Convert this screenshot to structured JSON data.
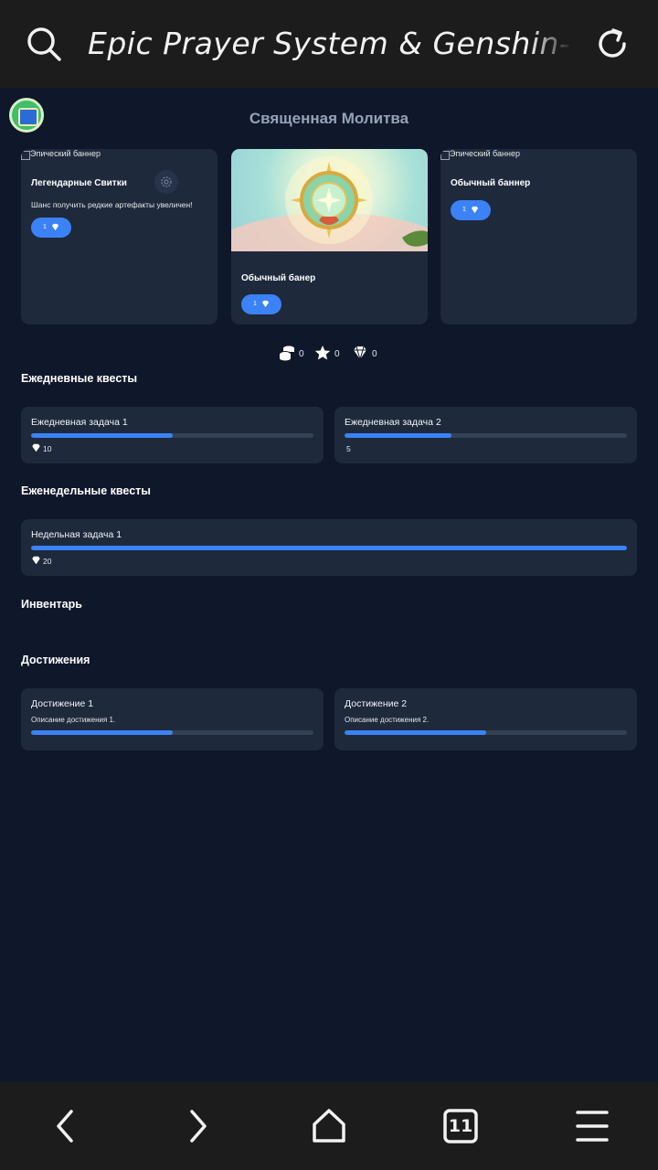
{
  "browser": {
    "title": "Epic Prayer System & Genshin-Sty",
    "tab_count": "11"
  },
  "page": {
    "title": "Священная Молитва"
  },
  "banners": [
    {
      "broken_alt": "Эпический баннер",
      "name": "Легендарные Свитки",
      "desc": "Шанс получить редкие артефакты увеличен!",
      "cost": "1"
    },
    {
      "name": "Обычный банер",
      "cost": "1"
    },
    {
      "broken_alt": "Эпический баннер",
      "name": "Обычный баннер",
      "cost": "1"
    }
  ],
  "currencies": [
    {
      "icon": "coins-icon",
      "value": "0"
    },
    {
      "icon": "star-icon",
      "value": "0"
    },
    {
      "icon": "gem-icon",
      "value": "0"
    }
  ],
  "daily": {
    "title": "Ежедневные квесты",
    "items": [
      {
        "name": "Ежедневная задача 1",
        "progress": 0.5,
        "reward": "10",
        "reward_icon": "gem-icon"
      },
      {
        "name": "Ежедневная задача 2",
        "progress": 0.38,
        "reward": "5"
      }
    ]
  },
  "weekly": {
    "title": "Еженедельные квесты",
    "items": [
      {
        "name": "Недельная задача 1",
        "progress": 1.0,
        "reward": "20",
        "reward_icon": "gem-icon"
      }
    ]
  },
  "inventory": {
    "title": "Инвентарь"
  },
  "achievements": {
    "title": "Достижения",
    "items": [
      {
        "name": "Достижение 1",
        "desc": "Описание достижения 1.",
        "progress": 0.5
      },
      {
        "name": "Достижение 2",
        "desc": "Описание достижения 2.",
        "progress": 0.5
      }
    ]
  },
  "colors": {
    "accent": "#3b82f6",
    "card": "#1e293b",
    "background": "#0f172a"
  }
}
